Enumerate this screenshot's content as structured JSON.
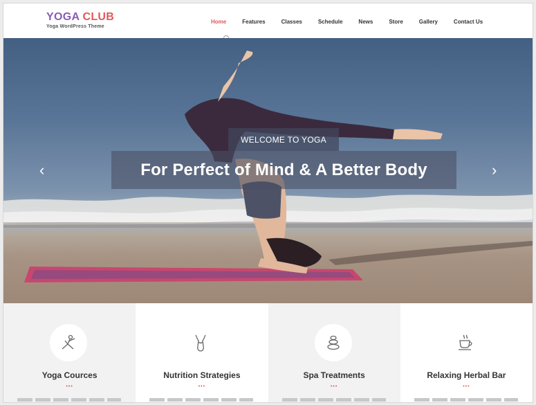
{
  "logo": {
    "title_part1": "YOGA",
    "title_part2": "CLUB",
    "subtitle": "Yoga WordPress Theme"
  },
  "nav": {
    "items": [
      {
        "label": "Home",
        "active": true
      },
      {
        "label": "Features"
      },
      {
        "label": "Classes"
      },
      {
        "label": "Schedule"
      },
      {
        "label": "News"
      },
      {
        "label": "Store"
      },
      {
        "label": "Gallery"
      },
      {
        "label": "Contact Us"
      }
    ]
  },
  "hero": {
    "welcome": "WELCOME TO YOGA",
    "title": "For Perfect of Mind & A Better Body",
    "prev_arrow": "‹",
    "next_arrow": "›"
  },
  "features": [
    {
      "title": "Yoga Cources",
      "icon": "yoga-pose-icon",
      "dots": "•••"
    },
    {
      "title": "Nutrition Strategies",
      "icon": "body-figure-icon",
      "dots": "•••"
    },
    {
      "title": "Spa Treatments",
      "icon": "spa-stones-icon",
      "dots": "•••"
    },
    {
      "title": "Relaxing Herbal Bar",
      "icon": "tea-cup-icon",
      "dots": "•••"
    }
  ],
  "colors": {
    "brand_purple": "#8a5cb5",
    "brand_red": "#e2585b",
    "text_dark": "#333333"
  }
}
